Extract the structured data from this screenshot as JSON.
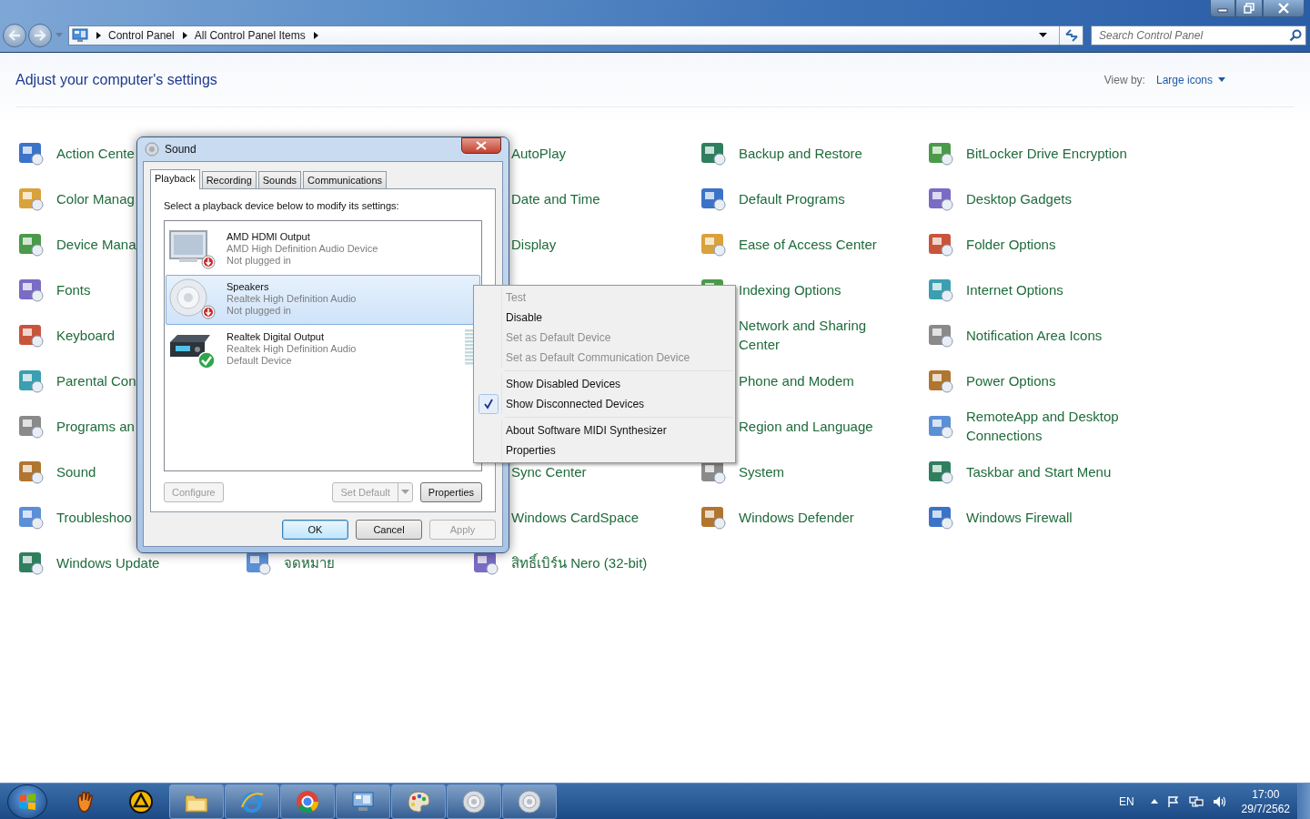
{
  "address_bar": {
    "breadcrumbs": [
      "Control Panel",
      "All Control Panel Items"
    ]
  },
  "search": {
    "placeholder": "Search Control Panel"
  },
  "header": {
    "title": "Adjust your computer's settings",
    "view_by_label": "View by:",
    "view_by_value": "Large icons"
  },
  "columns": [
    {
      "top": [
        "Action Cente",
        "Color Manag",
        "Device Mana",
        "Fonts",
        "Keyboard",
        "Parental Con",
        "Programs an",
        "Sound",
        "Troubleshoo",
        "Windows Update"
      ]
    },
    {
      "bottom": [
        "จดหมาย"
      ]
    },
    {
      "top": [
        "AutoPlay",
        "Date and Time",
        "Display"
      ],
      "bottom": [
        "Sync Center",
        "Windows CardSpace",
        "สิทธิ์เบิร์น Nero (32-bit)"
      ]
    },
    {
      "top": [
        "Backup and Restore",
        "Default Programs",
        "Ease of Access Center",
        "Indexing Options",
        "Network and Sharing Center",
        "Phone and Modem",
        "Region and Language",
        "System",
        "Windows Defender"
      ]
    },
    {
      "top": [
        "BitLocker Drive Encryption",
        "Desktop Gadgets",
        "Folder Options",
        "Internet Options",
        "Notification Area Icons",
        "Power Options",
        "RemoteApp and Desktop Connections",
        "Taskbar and Start Menu",
        "Windows Firewall"
      ]
    }
  ],
  "dialog": {
    "title": "Sound",
    "tabs": [
      {
        "label": "Playback",
        "selected": true
      },
      {
        "label": "Recording",
        "selected": false
      },
      {
        "label": "Sounds",
        "selected": false
      },
      {
        "label": "Communications",
        "selected": false
      }
    ],
    "instruction": "Select a playback device below to modify its settings:",
    "devices": [
      {
        "kind": "monitor",
        "name": "AMD HDMI Output",
        "driver": "AMD High Definition Audio Device",
        "status": "Not plugged in",
        "plugged": false,
        "default": false,
        "selected": false
      },
      {
        "kind": "speaker",
        "name": "Speakers",
        "driver": "Realtek High Definition Audio",
        "status": "Not plugged in",
        "plugged": false,
        "default": false,
        "selected": true
      },
      {
        "kind": "receiver",
        "name": "Realtek Digital Output",
        "driver": "Realtek High Definition Audio",
        "status": "Default Device",
        "plugged": true,
        "default": true,
        "selected": false
      }
    ],
    "panel_buttons": [
      {
        "label": "Configure",
        "kind": "plain",
        "disabled": true
      },
      {
        "label": "Set Default",
        "kind": "split",
        "disabled": true
      },
      {
        "label": "Properties",
        "kind": "plain",
        "disabled": false
      }
    ],
    "buttons": [
      {
        "label": "OK",
        "disabled": false,
        "default": true
      },
      {
        "label": "Cancel",
        "disabled": false,
        "default": false
      },
      {
        "label": "Apply",
        "disabled": true,
        "default": false
      }
    ]
  },
  "context_menu": {
    "groups": [
      [
        {
          "label": "Test",
          "disabled": true,
          "checked": false
        },
        {
          "label": "Disable",
          "disabled": false,
          "checked": false
        },
        {
          "label": "Set as Default Device",
          "disabled": true,
          "checked": false
        },
        {
          "label": "Set as Default Communication Device",
          "disabled": true,
          "checked": false
        }
      ],
      [
        {
          "label": "Show Disabled Devices",
          "disabled": false,
          "checked": false
        },
        {
          "label": "Show Disconnected Devices",
          "disabled": false,
          "checked": true
        }
      ],
      [
        {
          "label": "About Software MIDI Synthesizer",
          "disabled": false,
          "checked": false
        },
        {
          "label": "Properties",
          "disabled": false,
          "checked": false
        }
      ]
    ]
  },
  "taskbar": {
    "language": "EN",
    "time": "17:00",
    "date": "29/7/2562"
  }
}
